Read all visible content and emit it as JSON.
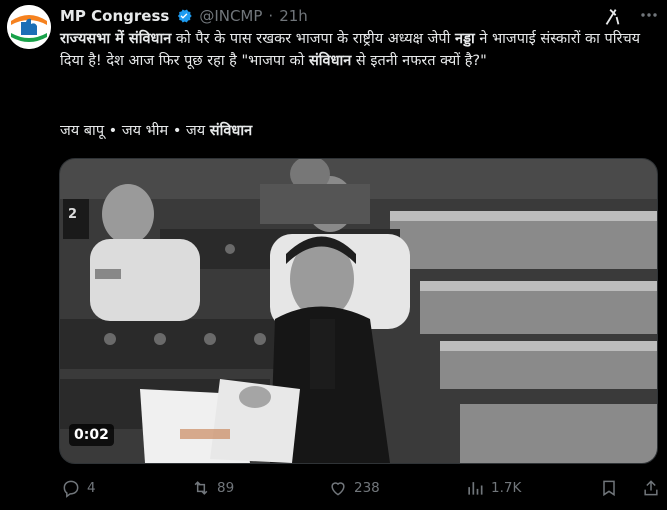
{
  "author": {
    "name": "MP Congress",
    "handle": "@INCMP",
    "separator": "·",
    "time": "21h"
  },
  "tweet": {
    "p1": "राज्यसभा में संविधान",
    "p2": " को पैर के पास रखकर भाजपा के राष्ट्रीय अध्यक्ष जेपी ",
    "p3": "नड्डा",
    "p4": " ने भाजपाई संस्कारों का परिचय दिया है! देश आज फिर पूछ रहा है \"भाजपा को ",
    "p5": "संविधान",
    "p6": " से इतनी नफरत क्यों है?\"",
    "hash_prefix": "जय बापू • जय भीम • जय ",
    "hash_bold": "संविधान"
  },
  "video": {
    "duration": "0:02",
    "signage": "2"
  },
  "actions": {
    "replies": "4",
    "reposts": "89",
    "likes": "238",
    "views": "1.7K"
  },
  "icons": [
    "congress-logo-icon",
    "verified-badge-icon",
    "grok-icon",
    "more-icon",
    "reply-icon",
    "repost-icon",
    "like-icon",
    "views-icon",
    "bookmark-icon",
    "share-icon"
  ],
  "colors": {
    "background": "#000000",
    "text": "#e7e9ea",
    "muted": "#71767b",
    "verified": "#1d9bf0"
  }
}
